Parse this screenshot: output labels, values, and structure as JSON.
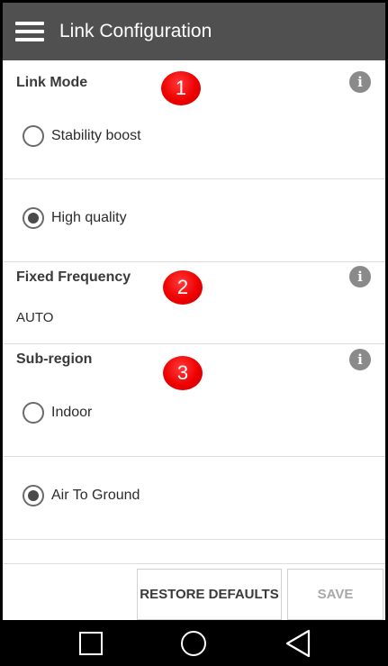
{
  "app_bar": {
    "title": "Link Configuration"
  },
  "sections": {
    "link_mode": {
      "title": "Link Mode",
      "marker": "1",
      "options": [
        {
          "label": "Stability boost",
          "selected": false
        },
        {
          "label": "High quality",
          "selected": true
        }
      ]
    },
    "fixed_frequency": {
      "title": "Fixed Frequency",
      "marker": "2",
      "value": "AUTO"
    },
    "sub_region": {
      "title": "Sub-region",
      "marker": "3",
      "options": [
        {
          "label": "Indoor",
          "selected": false
        },
        {
          "label": "Air To Ground",
          "selected": true
        }
      ]
    }
  },
  "buttons": {
    "restore_defaults": "RESTORE DEFAULTS",
    "save": "SAVE",
    "save_enabled": false
  },
  "colors": {
    "app_bar": "#505050",
    "marker": "#ee0000",
    "info_icon": "#8a8a8a",
    "save_disabled_text": "#a8a8a8"
  },
  "icons": {
    "menu": "hamburger-menu-icon",
    "info": "info-icon",
    "nav_recents": "square-icon",
    "nav_home": "circle-icon",
    "nav_back": "triangle-back-icon"
  }
}
